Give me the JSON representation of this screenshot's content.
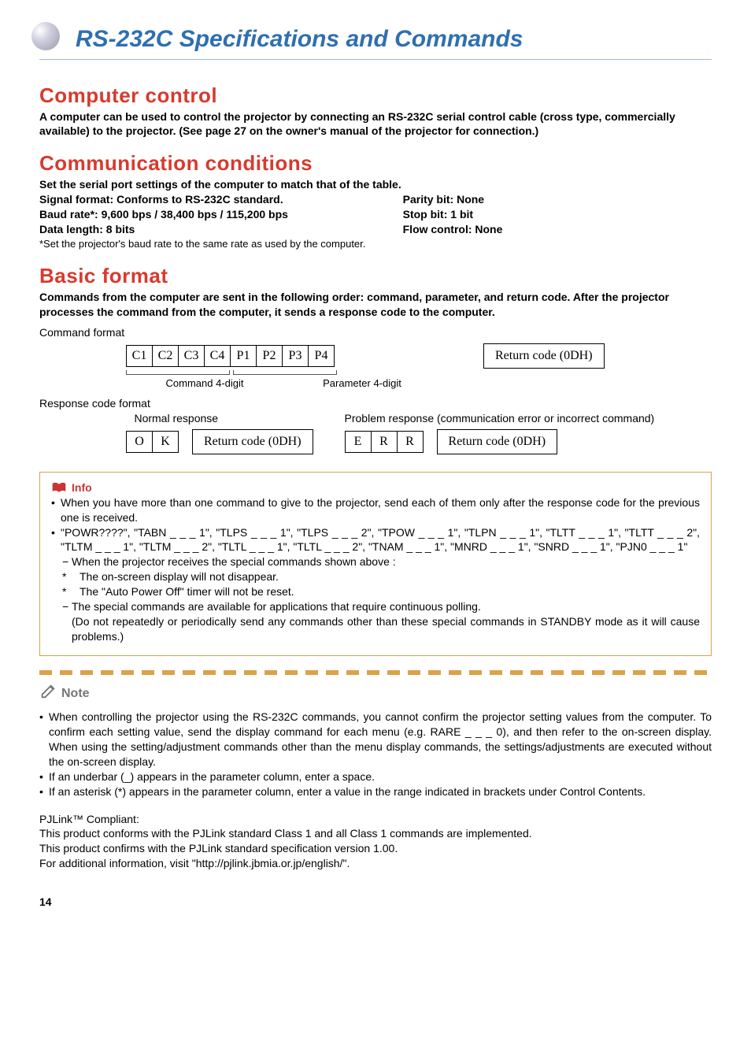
{
  "title": "RS-232C Specifications and Commands",
  "sections": {
    "computer_control": {
      "heading": "Computer control",
      "text": "A computer can be used to control the projector by connecting an RS-232C serial control cable (cross type, commercially available) to the projector. (See page 27 on the owner's manual of the projector for connection.)"
    },
    "communication": {
      "heading": "Communication conditions",
      "lead": "Set the serial port settings of the computer to match that of the table.",
      "left": [
        "Signal format: Conforms to RS-232C standard.",
        "Baud rate*: 9,600 bps / 38,400 bps / 115,200 bps",
        "Data length: 8 bits"
      ],
      "right": [
        "Parity bit: None",
        "Stop bit: 1 bit",
        "Flow control: None"
      ],
      "footnote": "*Set the projector's baud rate to the same rate as used by the computer."
    },
    "basic_format": {
      "heading": "Basic format",
      "text": "Commands from the computer are sent in the following order: command, parameter, and return code. After the projector processes the command from the computer, it sends a response code to the computer.",
      "command_format_label": "Command format",
      "command_cells": [
        "C1",
        "C2",
        "C3",
        "C4",
        "P1",
        "P2",
        "P3",
        "P4"
      ],
      "return_code": "Return code (0DH)",
      "brace_command": "Command 4-digit",
      "brace_param": "Parameter 4-digit",
      "response_label": "Response code format",
      "normal_label": "Normal response",
      "normal_cells": [
        "O",
        "K"
      ],
      "problem_label": "Problem response (communication error or incorrect command)",
      "problem_cells": [
        "E",
        "R",
        "R"
      ]
    }
  },
  "info": {
    "title": "Info",
    "bullets": [
      "When you have more than one command to give to the projector, send each of them only after the response code for the previous one is received.",
      "\"POWR????\", \"TABN _ _ _ 1\", \"TLPS _ _ _ 1\", \"TLPS _ _ _ 2\", \"TPOW _ _ _ 1\", \"TLPN _ _ _ 1\", \"TLTT _ _ _ 1\", \"TLTT _ _ _ 2\", \"TLTM _ _ _ 1\", \"TLTM _ _ _ 2\", \"TLTL _ _ _ 1\", \"TLTL _ _ _ 2\", \"TNAM _ _ _ 1\", \"MNRD _ _ _ 1\", \"SNRD _ _ _ 1\", \"PJN0 _ _ _ 1\""
    ],
    "sub": [
      {
        "mark": "dash",
        "text": "When the projector receives the special commands shown above :"
      },
      {
        "mark": "star",
        "text": "The on-screen display will not disappear."
      },
      {
        "mark": "star",
        "text": "The \"Auto Power Off\" timer will not be reset."
      },
      {
        "mark": "dash",
        "text": "The special commands are available for applications that require continuous polling."
      }
    ],
    "tail": "(Do not repeatedly or periodically send any commands other than these special commands in STANDBY mode as it will cause problems.)"
  },
  "note": {
    "title": "Note",
    "bullets": [
      "When controlling the projector using the RS-232C commands, you cannot confirm the projector setting values from the computer. To confirm each setting value, send the display command for each menu (e.g. RARE _ _ _ 0), and then refer to the on-screen display. When using the setting/adjustment commands other than the menu display commands, the settings/adjustments are executed without the on-screen display.",
      "If an underbar (_) appears in the parameter column, enter a space.",
      "If an asterisk (*) appears in the parameter column, enter a value in the range indicated in brackets under Control Contents."
    ]
  },
  "pjlink": {
    "label": "PJLink™ Compliant:",
    "lines": [
      "This product conforms with the PJLink standard Class 1 and all Class 1 commands are implemented.",
      "This product confirms with the PJLink standard specification version 1.00.",
      "For additional information, visit \"http://pjlink.jbmia.or.jp/english/\"."
    ]
  },
  "page_number": "14"
}
